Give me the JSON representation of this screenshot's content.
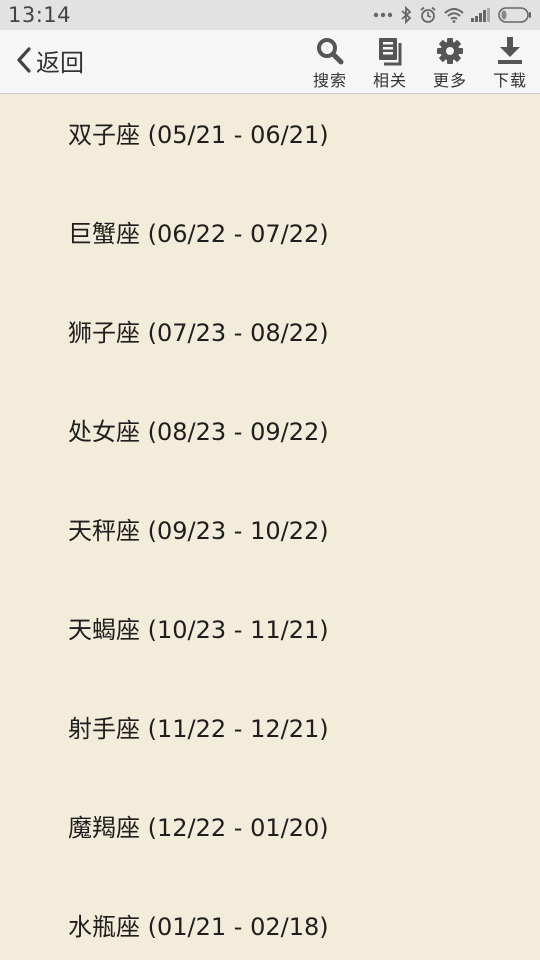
{
  "status_bar": {
    "time": "13:14",
    "icons": [
      "more-dots-icon",
      "bluetooth-icon",
      "alarm-icon",
      "wifi-icon",
      "signal-icon",
      "battery-icon"
    ]
  },
  "toolbar": {
    "back_label": "返回",
    "search_label": "搜索",
    "related_label": "相关",
    "more_label": "更多",
    "download_label": "下载"
  },
  "colors": {
    "background": "#f3ecda",
    "toolbar": "#f6f6f6",
    "status_bar": "#e2e2e2",
    "text": "#1e1e1e",
    "icon": "#555555"
  },
  "list": {
    "items": [
      {
        "label": "双子座 (05/21 - 06/21)"
      },
      {
        "label": "巨蟹座 (06/22 - 07/22)"
      },
      {
        "label": "狮子座 (07/23 - 08/22)"
      },
      {
        "label": "处女座 (08/23 - 09/22)"
      },
      {
        "label": "天秤座 (09/23 - 10/22)"
      },
      {
        "label": "天蝎座 (10/23 - 11/21)"
      },
      {
        "label": "射手座 (11/22 - 12/21)"
      },
      {
        "label": "魔羯座 (12/22 - 01/20)"
      },
      {
        "label": "水瓶座 (01/21 - 02/18)"
      }
    ]
  }
}
